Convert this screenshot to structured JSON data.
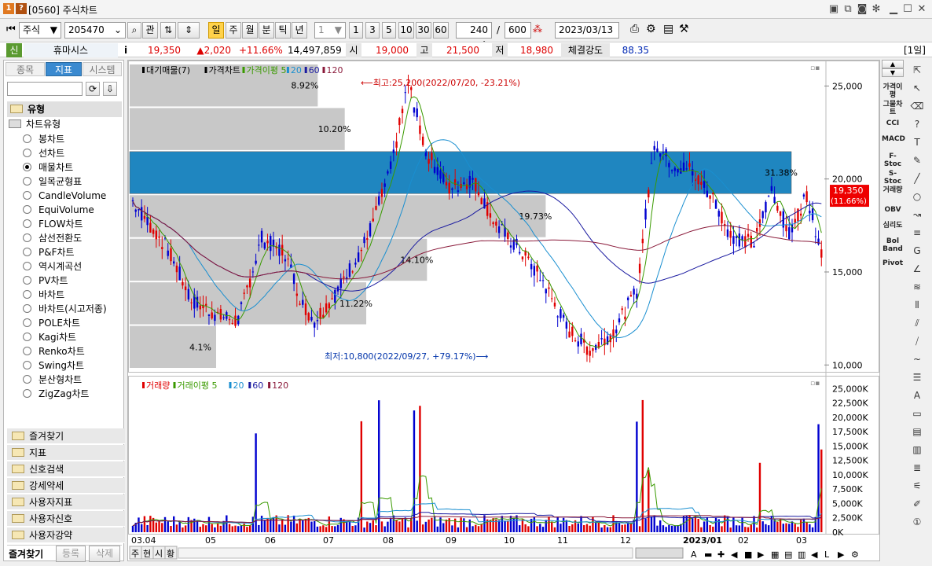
{
  "window": {
    "code": "[0560]",
    "title": "주식차트",
    "badge1": "1",
    "badge2": "?"
  },
  "toolbar": {
    "market": "주식",
    "code": "205470",
    "zoom_label": "관",
    "periods": [
      "일",
      "주",
      "월",
      "분",
      "틱",
      "년"
    ],
    "tick_value": "1",
    "quick_counts": [
      "1",
      "3",
      "5",
      "10",
      "30",
      "60"
    ],
    "display_count": "240",
    "total_count": "600",
    "date": "2023/03/13"
  },
  "pricebar": {
    "market_short": "신",
    "name": "휴마시스",
    "info": "i",
    "price": "19,350",
    "change": "▲2,020",
    "change_pct": "+11.66%",
    "volume": "14,497,859",
    "open_label": "시",
    "open": "19,000",
    "high_label": "고",
    "high": "21,500",
    "low_label": "저",
    "low": "18,980",
    "strength_label": "체결강도",
    "strength": "88.35",
    "period_badge": "[1일]"
  },
  "leftpanel": {
    "tabs": [
      "종목",
      "지표",
      "시스템"
    ],
    "section": "유형",
    "group": "차트유형",
    "chart_types": [
      "봉차트",
      "선차트",
      "매물차트",
      "일목균형표",
      "CandleVolume",
      "EquiVolume",
      "FLOW차트",
      "삼선전환도",
      "P&F차트",
      "역시계곡선",
      "PV차트",
      "바차트",
      "바차트(시고저종)",
      "POLE차트",
      "Kagi차트",
      "Renko차트",
      "Swing차트",
      "분산형차트",
      "ZigZag차트"
    ],
    "selected_index": 2,
    "bottom_folders": [
      "즐겨찾기",
      "지표",
      "신호검색",
      "강세약세",
      "사용자지표",
      "사용자신호",
      "사용자강약"
    ],
    "footer": [
      "즐겨찾기",
      "등록",
      "삭제"
    ]
  },
  "chart": {
    "price_legend": [
      "대기매물(7)",
      "가격차트",
      "가격이평 5",
      "20",
      "60",
      "120"
    ],
    "volume_legend": [
      "거래량",
      "거래이평 5",
      "20",
      "60",
      "120"
    ],
    "high_annot": "⟵최고:25,200(2022/07/20, -23.21%)",
    "low_annot": "최저:10,800(2022/09/27, +79.17%)⟶",
    "current_price": "19,350",
    "current_pct": "(11.66%)",
    "price_ticks": [
      "25,000",
      "20,000",
      "15,000",
      "10,000"
    ],
    "volume_ticks": [
      "25,000K",
      "22,500K",
      "20,000K",
      "17,500K",
      "15,000K",
      "12,500K",
      "10,000K",
      "7,500K",
      "5,000K",
      "2,500K",
      "0K"
    ],
    "x_labels": [
      "03.04",
      "05",
      "06",
      "07",
      "08",
      "09",
      "10",
      "11",
      "12",
      "2023/01",
      "02",
      "03"
    ],
    "bottom_tabs": [
      "주",
      "현",
      "시",
      "황"
    ],
    "colors": {
      "up": "#e00000",
      "down": "#0000d0",
      "ma5": "#3a9a00",
      "ma20": "#1a8fd0",
      "ma60": "#1a1aa0",
      "ma120": "#8a1a3a",
      "band_blue": "#1f86c0",
      "band_gray": "#c8c8c8"
    }
  },
  "chart_data": {
    "type": "bar",
    "title": "대기매물(7)",
    "categories": [
      "~11,000",
      "~13,000",
      "~15,000",
      "~17,000",
      "~19,000",
      "~21,000",
      "~23,000"
    ],
    "values": [
      4.1,
      11.22,
      14.1,
      19.73,
      31.38,
      10.2,
      8.92
    ],
    "labels": [
      "4.1%",
      "11.22%",
      "14.10%",
      "19.73%",
      "31.38%",
      "10.20%",
      "8.92%"
    ],
    "unit": "%",
    "price_range": [
      9800,
      26200
    ]
  },
  "rightbar": {
    "labels": [
      "가격이평",
      "그물차트",
      "CCI",
      "MACD",
      "F-Stoc",
      "S-Stoc",
      "거래량",
      "OBV",
      "심리도",
      "Bol Band",
      "Pivot"
    ]
  }
}
